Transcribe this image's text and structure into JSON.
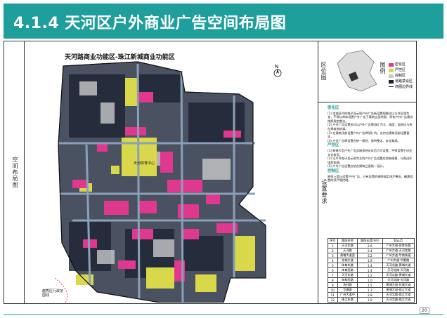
{
  "header": {
    "title": "4.1.4 天河区户外商业广告空间布局图"
  },
  "map": {
    "title": "天河路商业功能区-珠江新城商业功能区",
    "north": "N",
    "boundary_label": "越秀区行政范围线",
    "area_label": "天河体育中心"
  },
  "side_labels": {
    "left": "空间布局图",
    "inset": "区位图",
    "legend": "图例",
    "requirements": "设置要求"
  },
  "legend": {
    "items": [
      {
        "label": "密化区",
        "color": "#e0378f"
      },
      {
        "label": "严控区",
        "color": "#d8d84a"
      },
      {
        "label": "控制区",
        "color": "#c9c9c9"
      },
      {
        "label": "道路禁设区",
        "color": "#1c2433"
      },
      {
        "label": "商圈边界线",
        "color": "#111111"
      }
    ]
  },
  "requirements": {
    "sections": [
      {
        "title": "密化区",
        "lines": [
          "(1) 本城区内的电子显示屏户外广告新设置规模应以公共区域为宜，不得以单体设置户外广告于建筑立面地面；原有户外广告建议按照规定整治。",
          "(2) 户外广告设置形式以户外广告牌(屏) 为主，高度、面积应与所在建筑物协调。",
          "(3) 在建筑顶部设置户外广告牌(屏) 的，应符合建筑顶部设置要求。",
          "(4) 户外广告牌设置应统一规划、保持整洁、安全美观。"
        ]
      },
      {
        "title": "严控区",
        "lines": [
          "(1) 新建大型户外广告设施须经论证后方可设置，不得设置于历史文化街区。",
          "(2) 以户外电子显示屏为主的户外广告设置应控制规模，与周边环境相协调。",
          "(3) 户外广告设置应结合建筑立面统一设计。"
        ]
      },
      {
        "title": "控制区",
        "lines": [
          "原则上禁止设置户外广告，已有设置的按照规定逐步整治，确需设置的须严格控制。"
        ]
      }
    ]
  },
  "table": {
    "headers": [
      "序号",
      "路段名称",
      "路段长度(km)",
      "起止点"
    ],
    "rows": [
      [
        "1",
        "天河北路",
        "2.6",
        "广州大道-体育东路"
      ],
      [
        "2",
        "天河路",
        "2.4",
        "广州大道-天河北路"
      ],
      [
        "3",
        "黄埔大道西",
        "3.2",
        "广州大道-华南快速"
      ],
      [
        "4",
        "花城大道",
        "1.9",
        "广州大道-华夏路"
      ],
      [
        "5",
        "体育东路",
        "1.4",
        "天河北路-黄埔大道"
      ],
      [
        "6",
        "体育西路",
        "1.4",
        "天河北路-天河路"
      ],
      [
        "7",
        "天河东路",
        "1.2",
        "天河北路-黄埔大道"
      ],
      [
        "8",
        "林和西路",
        "1.0",
        "天河北路-天河路"
      ],
      [
        "9",
        "冼村路",
        "1.5",
        "黄埔大道-花城大道"
      ],
      [
        "10",
        "华夏路",
        "1.3",
        "黄埔大道-临江大道"
      ],
      [
        "11",
        "广州大道中",
        "2.8",
        "天河北路-临江大道"
      ],
      [
        "12",
        "珠江东路",
        "1.8",
        "天河北路-临江大道"
      ]
    ]
  },
  "page_number": "20"
}
